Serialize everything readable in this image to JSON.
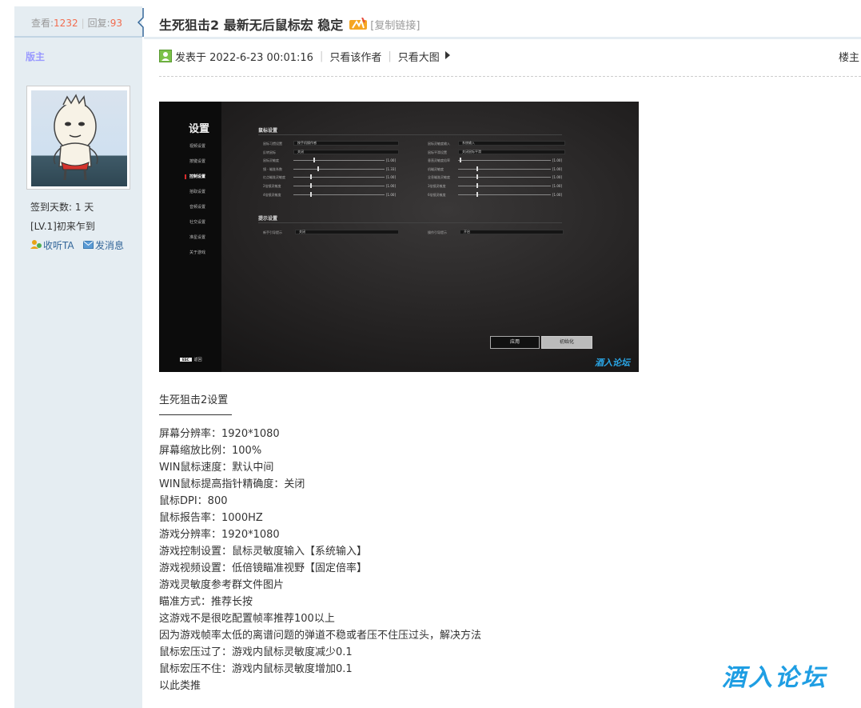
{
  "thread": {
    "views_label": "查看:",
    "views": "1232",
    "replies_label": "回复:",
    "replies": "93",
    "title": "生死狙击2 最新无后鼠标宏 稳定",
    "copy_link": "[复制链接]"
  },
  "author": {
    "name": "版主",
    "checkin": "签到天数: 1 天",
    "level": "[LV.1]初来乍到",
    "follow": "收听TA",
    "message": "发消息"
  },
  "post": {
    "posted": "发表于 2022-6-23 00:01:16",
    "only_author": "只看该作者",
    "only_images": "只看大图",
    "floor": "楼主"
  },
  "screenshot": {
    "heading": "设置",
    "menu": [
      "视频设置",
      "按键设置",
      "控制设置",
      "拾取设置",
      "音频设置",
      "社交设置",
      "准星设置",
      "关于游戏"
    ],
    "active_index": 2,
    "section_mouse": "鼠标设置",
    "section_hint": "提示设置",
    "left_rows": [
      {
        "label": "鼠标习惯设置",
        "type": "select",
        "value": "按手机操作感"
      },
      {
        "label": "反转鼠标",
        "type": "select",
        "value": "关闭"
      },
      {
        "label": "鼠标灵敏度",
        "type": "slider",
        "value": "[1.00]",
        "level": 0.22
      },
      {
        "label": "镜 - 瞄准系数",
        "type": "slider",
        "value": "[1.33]",
        "level": 0.26
      },
      {
        "label": "红点瞄准灵敏度",
        "type": "slider",
        "value": "[1.00]",
        "level": 0.18
      },
      {
        "label": "2倍镜灵敏度",
        "type": "slider",
        "value": "[1.00]",
        "level": 0.18
      },
      {
        "label": "4倍镜灵敏度",
        "type": "slider",
        "value": "[1.00]",
        "level": 0.18
      }
    ],
    "right_rows": [
      {
        "label": "鼠标灵敏度输入",
        "type": "select",
        "value": "系统输入"
      },
      {
        "label": "鼠标平滑设置",
        "type": "select",
        "value": "关闭鼠标平滑"
      },
      {
        "label": "垂直灵敏度倍率",
        "type": "slider",
        "value": "[1.00]",
        "level": 0.02
      },
      {
        "label": "机瞄灵敏度",
        "type": "slider",
        "value": "[1.00]",
        "level": 0.2
      },
      {
        "label": "全息瞄准灵敏度",
        "type": "slider",
        "value": "[1.00]",
        "level": 0.2
      },
      {
        "label": "3倍镜灵敏度",
        "type": "slider",
        "value": "[1.00]",
        "level": 0.2
      },
      {
        "label": "6倍镜灵敏度",
        "type": "slider",
        "value": "[1.00]",
        "level": 0.2
      }
    ],
    "hint_left": {
      "label": "新手引导提示",
      "value": "关闭"
    },
    "hint_right": {
      "label": "操作引导提示",
      "value": "开启"
    },
    "apply": "应用",
    "reset": "初始化",
    "esc_key": "ESC",
    "esc_label": "返回",
    "watermark": "酒入论坛"
  },
  "content": {
    "intro": "生死狙击2设置",
    "lines": [
      "屏幕分辨率：1920*1080",
      "屏幕缩放比例：100%",
      "WIN鼠标速度：默认中间",
      "WIN鼠标提高指针精确度：关闭",
      "鼠标DPI：800",
      "鼠标报告率：1000HZ",
      "游戏分辨率：1920*1080",
      "游戏控制设置：鼠标灵敏度输入【系统输入】",
      "游戏视频设置：低倍镜瞄准视野【固定倍率】",
      "游戏灵敏度参考群文件图片",
      "瞄准方式：推荐长按",
      "这游戏不是很吃配置帧率推荐100以上",
      "因为游戏帧率太低的离谱问题的弹道不稳或者压不住压过头，解决方法",
      "鼠标宏压过了：游戏内鼠标灵敏度减少0.1",
      "鼠标宏压不住：游戏内鼠标灵敏度增加0.1",
      "以此类推"
    ]
  },
  "watermark": "酒入论坛",
  "colors": {
    "accent": "#336699",
    "stat_number": "#f26c4f",
    "sidebar_bg": "#e5edf2",
    "watermark": "#1f9ee3"
  }
}
